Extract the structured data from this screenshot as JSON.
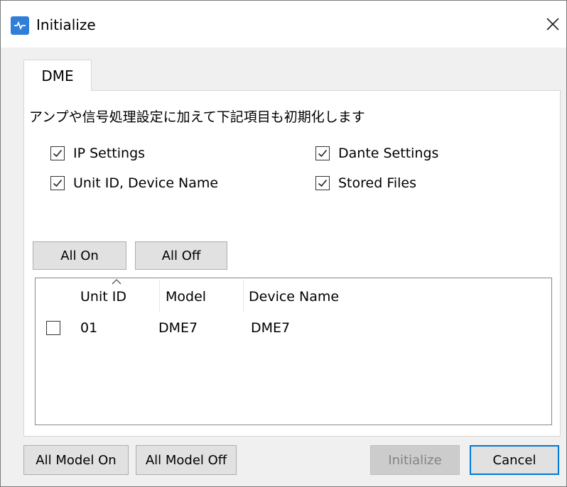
{
  "window": {
    "title": "Initialize",
    "app_icon": "app-icon",
    "close_icon": "close-icon"
  },
  "tabs": [
    {
      "label": "DME",
      "selected": true
    }
  ],
  "description": "アンプや信号処理設定に加えて下記項目も初期化します",
  "options": [
    {
      "label": "IP Settings",
      "checked": true
    },
    {
      "label": "Dante Settings",
      "checked": true
    },
    {
      "label": "Unit ID, Device Name",
      "checked": true
    },
    {
      "label": "Stored Files",
      "checked": true
    }
  ],
  "buttons": {
    "all_on": "All On",
    "all_off": "All Off",
    "all_model_on": "All Model On",
    "all_model_off": "All Model Off",
    "initialize": "Initialize",
    "cancel": "Cancel"
  },
  "table": {
    "columns": [
      "Unit ID",
      "Model",
      "Device Name"
    ],
    "sort_column": "Unit ID",
    "sort_direction": "ascending",
    "rows": [
      {
        "checked": false,
        "unit_id": "01",
        "model": "DME7",
        "device_name": "DME7"
      }
    ]
  },
  "colors": {
    "accent": "#0078d7",
    "app_icon": "#2f7fd8",
    "disabled_text": "#838383"
  }
}
